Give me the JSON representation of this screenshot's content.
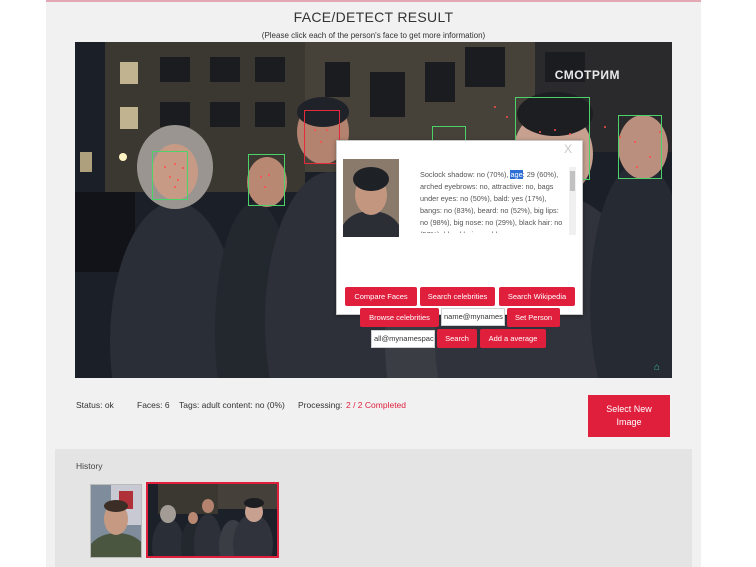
{
  "page": {
    "title": "FACE/DETECT RESULT",
    "subtitle": "(Please click each of the person's face to get more information)"
  },
  "image": {
    "watermark": "СМОТРИМ"
  },
  "popup": {
    "close_label": "X",
    "info_before": "Soclock shadow: no (70%), ",
    "info_highlight": "age",
    "info_after": ": 29 (60%), arched eyebrows: no, attractive: no, bags under eyes: no (50%), bald: yes (17%), bangs: no (83%), beard: no (52%), big lips: no (98%), big nose: no (29%), black hair: no (57%), blond hair: no, blurry: yes",
    "buttons": {
      "compare_faces": "Compare Faces",
      "search_celebrities": "Search celebrities",
      "search_wikipedia": "Search Wikipedia",
      "browse_celebrities": "Browse celebrities",
      "set_person": "Set Person",
      "search": "Search",
      "add_average": "Add a average"
    },
    "inputs": {
      "name_value": "name@mynames",
      "all_value": "all@mynamespac"
    }
  },
  "status": {
    "status_text": "Status: ok",
    "faces_text": "Faces: 6",
    "tags_text": "Tags: adult content: no (0%)",
    "processing_label": "Processing:",
    "processing_value": "2 / 2 Completed"
  },
  "select_button": {
    "line1": "Select New",
    "line2": "Image"
  },
  "history": {
    "label": "History"
  },
  "colors": {
    "accent": "#e01f3d",
    "face_box_green": "#4bd36a",
    "face_box_red": "#e32b3c",
    "panel_bg": "#f1f1f1"
  }
}
